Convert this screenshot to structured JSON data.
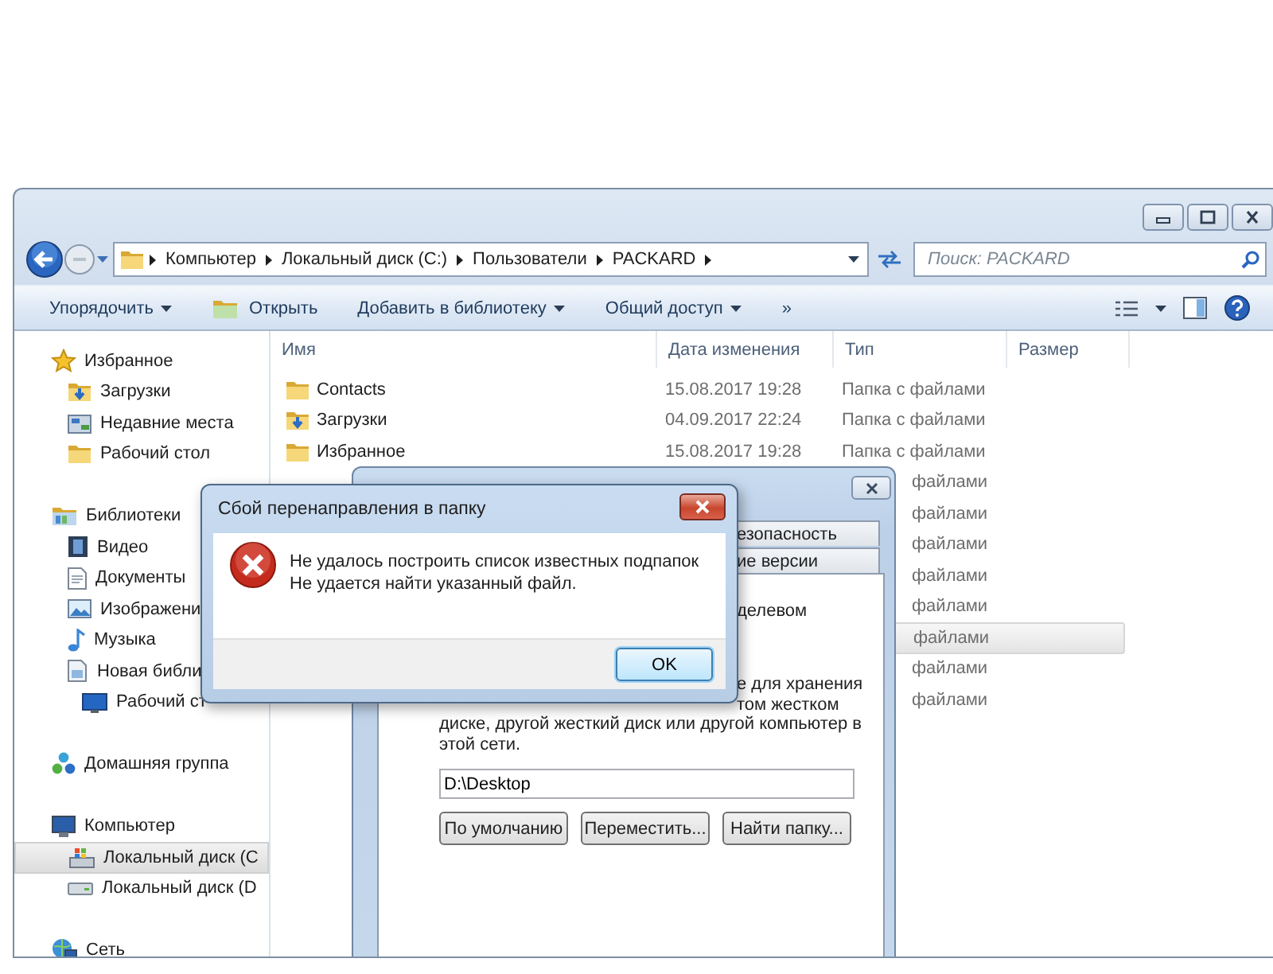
{
  "explorer": {
    "address": {
      "crumbs": [
        "Компьютер",
        "Локальный диск (C:)",
        "Пользователи",
        "PACKARD"
      ]
    },
    "search": {
      "placeholder": "Поиск: PACKARD"
    },
    "toolbar": [
      {
        "label": "Упорядочить",
        "kind": "menu"
      },
      {
        "label": "Открыть",
        "kind": "open"
      },
      {
        "label": "Добавить в библиотеку",
        "kind": "menu"
      },
      {
        "label": "Общий доступ",
        "kind": "menu"
      },
      {
        "label": "»",
        "kind": "more"
      }
    ],
    "sidebar": [
      {
        "label": "Избранное",
        "selected": false,
        "children": [
          {
            "label": "Загрузки",
            "selected": false
          },
          {
            "label": "Недавние места",
            "selected": false
          },
          {
            "label": "Рабочий стол",
            "selected": false
          }
        ]
      },
      {
        "label": "Библиотеки",
        "selected": false,
        "children": [
          {
            "label": "Видео",
            "selected": false
          },
          {
            "label": "Документы",
            "selected": false
          },
          {
            "label": "Изображени",
            "selected": false
          },
          {
            "label": "Музыка",
            "selected": false
          },
          {
            "label": "Новая библи",
            "selected": false,
            "children": [
              {
                "label": "Рабочий ст",
                "selected": false
              }
            ]
          }
        ]
      },
      {
        "label": "Домашняя группа",
        "selected": false
      },
      {
        "label": "Компьютер",
        "selected": false,
        "children": [
          {
            "label": "Локальный диск (C",
            "selected": true
          },
          {
            "label": "Локальный диск (D",
            "selected": false
          }
        ]
      },
      {
        "label": "Сеть",
        "selected": false
      }
    ],
    "columns": [
      "Имя",
      "Дата изменения",
      "Тип",
      "Размер"
    ],
    "rows": [
      {
        "name": "Contacts",
        "modified": "15.08.2017 19:28",
        "type": "Папка с файлами",
        "highlighted": false
      },
      {
        "name": "Загрузки",
        "modified": "04.09.2017 22:24",
        "type": "Папка с файлами",
        "highlighted": false
      },
      {
        "name": "Избранное",
        "modified": "15.08.2017 19:28",
        "type": "Папка с файлами",
        "highlighted": false
      },
      {
        "type": "файлами",
        "highlighted": false
      },
      {
        "type": "файлами",
        "highlighted": false
      },
      {
        "type": "файлами",
        "highlighted": false
      },
      {
        "type": "файлами",
        "highlighted": false
      },
      {
        "type": "файлами",
        "highlighted": false
      },
      {
        "type": "файлами",
        "highlighted": true
      },
      {
        "type": "файлами",
        "highlighted": false
      },
      {
        "type": "файлами",
        "highlighted": false
      }
    ]
  },
  "properties_dialog": {
    "tabs": [
      {
        "label": "езопасность",
        "selected": false
      },
      {
        "label": "ие версии",
        "selected": false
      }
    ],
    "fragments": [
      "делевом",
      "е для хранения",
      "том жестком"
    ],
    "paragraph_lines": [
      "диске, другой жесткий диск или другой компьютер в",
      "этой сети."
    ],
    "path_field": {
      "value": "D:\\Desktop"
    },
    "buttons": [
      "По умолчанию",
      "Переместить...",
      "Найти папку..."
    ]
  },
  "error_dialog": {
    "title": "Сбой перенаправления в папку",
    "lines": [
      "Не удалось построить список известных подпапок",
      "Не удается найти указанный файл."
    ],
    "buttons": [
      {
        "label": "OK",
        "default": true
      }
    ]
  }
}
